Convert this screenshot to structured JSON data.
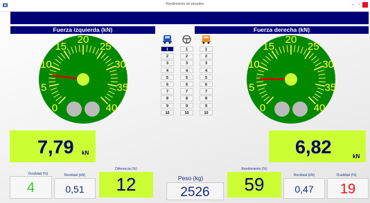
{
  "window": {
    "title": "Rendimiento de pesados"
  },
  "left": {
    "header": "Fuerza izquierda (kN)",
    "value": "7,79",
    "unit": "kN"
  },
  "right": {
    "header": "Fuerza derecha (kN)",
    "value": "6,82",
    "unit": "kN"
  },
  "gauge": {
    "ticks": [
      "0",
      "5",
      "10",
      "15",
      "20",
      "25",
      "30",
      "35",
      "40"
    ],
    "min": 0,
    "max": 40,
    "left_value": 7.79,
    "right_value": 6.82
  },
  "table": {
    "rows": [
      [
        "1",
        "1",
        "1"
      ],
      [
        "2",
        "2",
        "2"
      ],
      [
        "3",
        "3",
        "3"
      ],
      [
        "4",
        "4",
        "4"
      ],
      [
        "5",
        "5",
        "5"
      ],
      [
        "6",
        "6",
        "6"
      ],
      [
        "7",
        "7",
        "7"
      ],
      [
        "8",
        "8",
        "8"
      ],
      [
        "9",
        "9",
        "9"
      ],
      [
        "10",
        "10",
        "10"
      ]
    ],
    "selected_row": 0
  },
  "bottom": {
    "ovalidad_left": {
      "label": "Ovalidad (%)",
      "value": "4"
    },
    "residual_left": {
      "label": "Residual (kN)",
      "value": "0,51"
    },
    "diferencia": {
      "label": "Diferencia (%)",
      "value": "12"
    },
    "peso": {
      "label": "Peso (kg)",
      "value": "2526"
    },
    "rendimiento": {
      "label": "Rendimiento (%)",
      "value": "59"
    },
    "residual_right": {
      "label": "Residual (kN)",
      "value": "0,47"
    },
    "ovalidad_right": {
      "label": "Ovalidad (%)",
      "value": "19"
    }
  },
  "colors": {
    "navy": "#000077",
    "lime": "#ccff33",
    "gauge_green": "#008800",
    "needle": "#dd0000",
    "ovalidad_left": "#33cc33",
    "ovalidad_right": "#ee1111"
  }
}
